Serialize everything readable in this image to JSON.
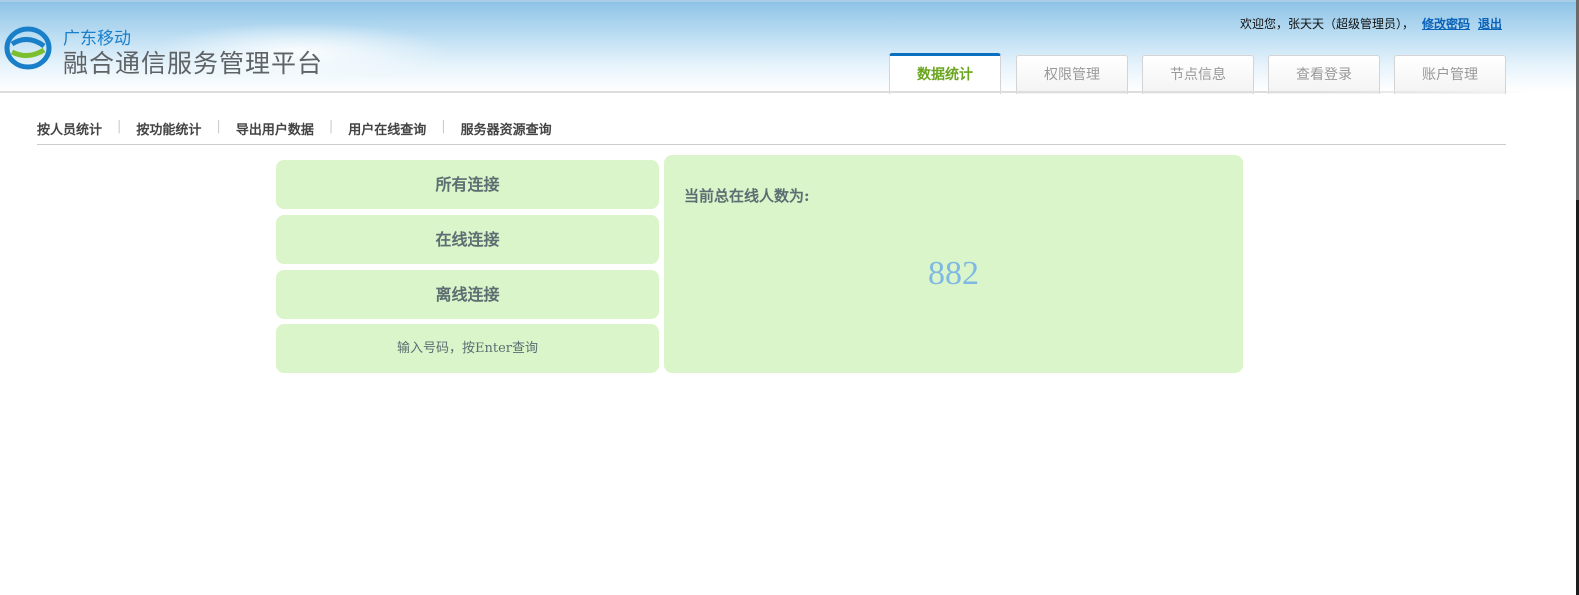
{
  "header": {
    "brand_top": "广东移动",
    "brand_title": "融合通信服务管理平台",
    "welcome": "欢迎您，张天天（超级管理员），",
    "change_password": "修改密码",
    "logout": "退出"
  },
  "tabs": [
    {
      "label": "数据统计",
      "active": true
    },
    {
      "label": "权限管理"
    },
    {
      "label": "节点信息"
    },
    {
      "label": "查看登录"
    },
    {
      "label": "账户管理"
    }
  ],
  "subnav": [
    "按人员统计",
    "按功能统计",
    "导出用户数据",
    "用户在线查询",
    "服务器资源查询"
  ],
  "buttons": {
    "all": "所有连接",
    "online": "在线连接",
    "offline": "离线连接",
    "query_placeholder": "输入号码，按Enter查询"
  },
  "panel": {
    "label": "当前总在线人数为:",
    "count": "882"
  },
  "colors": {
    "accent": "#0b6fc1",
    "active_tab": "#6aa51e",
    "panel_bg": "#daf5c9"
  }
}
